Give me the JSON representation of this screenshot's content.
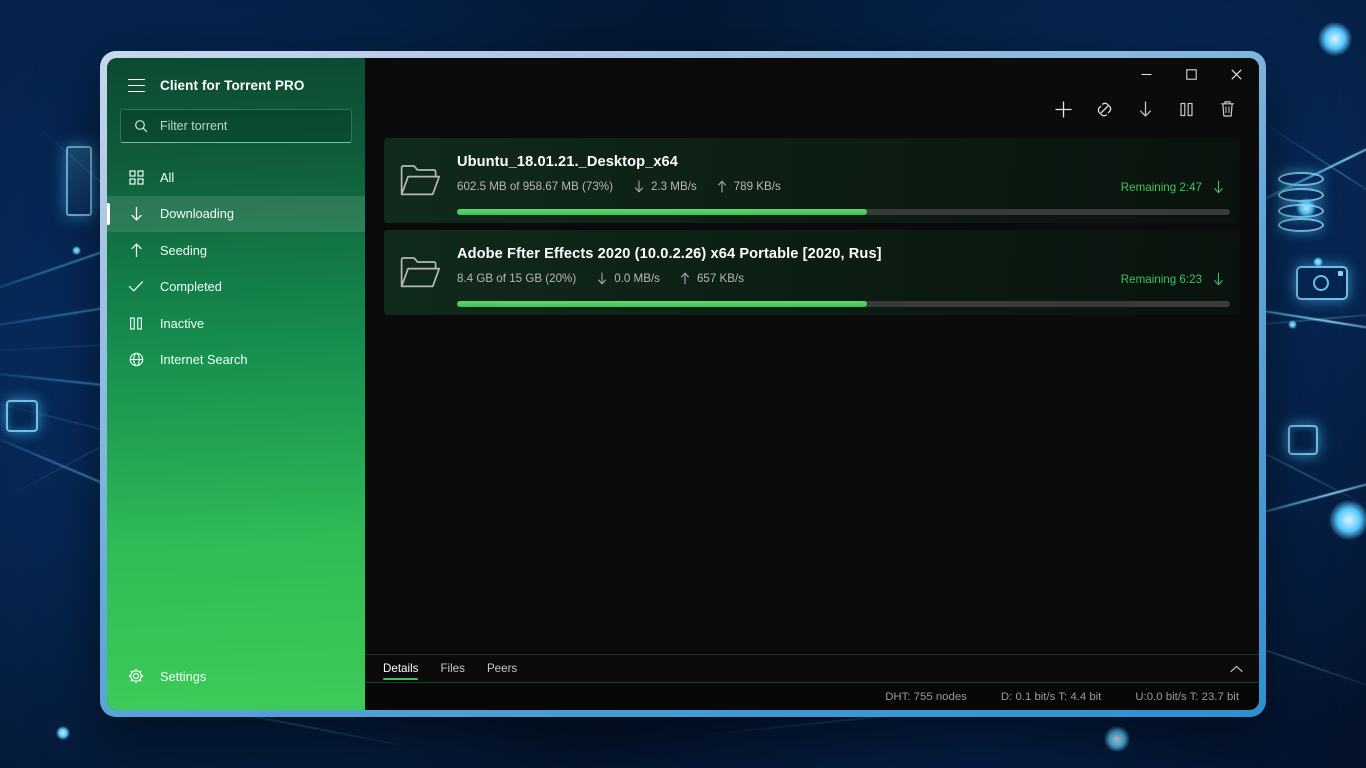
{
  "sidebar": {
    "menu_icon": "hamburger-icon",
    "app_title": "Client for Torrent PRO",
    "search": {
      "icon": "search-icon",
      "placeholder": "Filter torrent",
      "value": ""
    },
    "items": [
      {
        "label": "All",
        "icon": "grid-icon",
        "active": false
      },
      {
        "label": "Downloading",
        "icon": "download-icon",
        "active": true
      },
      {
        "label": "Seeding",
        "icon": "upload-icon",
        "active": false
      },
      {
        "label": "Completed",
        "icon": "check-icon",
        "active": false
      },
      {
        "label": "Inactive",
        "icon": "pause-icon",
        "active": false
      },
      {
        "label": "Internet Search",
        "icon": "globe-icon",
        "active": false
      }
    ],
    "settings": {
      "label": "Settings",
      "icon": "gear-icon"
    }
  },
  "titlebar": {
    "minimize": "minimize-icon",
    "maximize": "maximize-icon",
    "close": "close-icon"
  },
  "toolbar": {
    "buttons": [
      {
        "name": "add-torrent-button",
        "icon": "plus-icon"
      },
      {
        "name": "add-magnet-button",
        "icon": "magnet-link-icon"
      },
      {
        "name": "start-download-button",
        "icon": "download-arrow-icon"
      },
      {
        "name": "pause-button",
        "icon": "pause-icon"
      },
      {
        "name": "delete-button",
        "icon": "trash-icon"
      }
    ]
  },
  "torrents": [
    {
      "name": "Ubuntu_18.01.21._Desktop_x64",
      "size": "602.5 MB of 958.67 MB  (73%)",
      "down_rate": "2.3 MB/s",
      "up_rate": "789 KB/s",
      "remaining": "Remaining 2:47",
      "progress_percent": 53,
      "icon": "folder-icon"
    },
    {
      "name": "Adobe Ffter Effects 2020 (10.0.2.26) x64 Portable  [2020, Rus]",
      "size": "8.4 GB of 15 GB  (20%)",
      "down_rate": "0.0 MB/s",
      "up_rate": "657 KB/s",
      "remaining": "Remaining 6:23",
      "progress_percent": 53,
      "icon": "folder-icon"
    }
  ],
  "tabs": [
    {
      "label": "Details",
      "active": true
    },
    {
      "label": "Files",
      "active": false
    },
    {
      "label": "Peers",
      "active": false
    }
  ],
  "collapse_icon": "chevron-up-icon",
  "statusbar": {
    "dht": "DHT: 755 nodes",
    "download": "D: 0.1 bit/s T: 4.4 bit",
    "upload": "U:0.0 bit/s T: 23.7 bit"
  },
  "colors": {
    "accent_green": "#3fc362",
    "progress_green": "#4ecb61",
    "sidebar_top": "#0d4a33",
    "sidebar_bottom": "#3dcb58",
    "window_border": "#2f90cf"
  }
}
